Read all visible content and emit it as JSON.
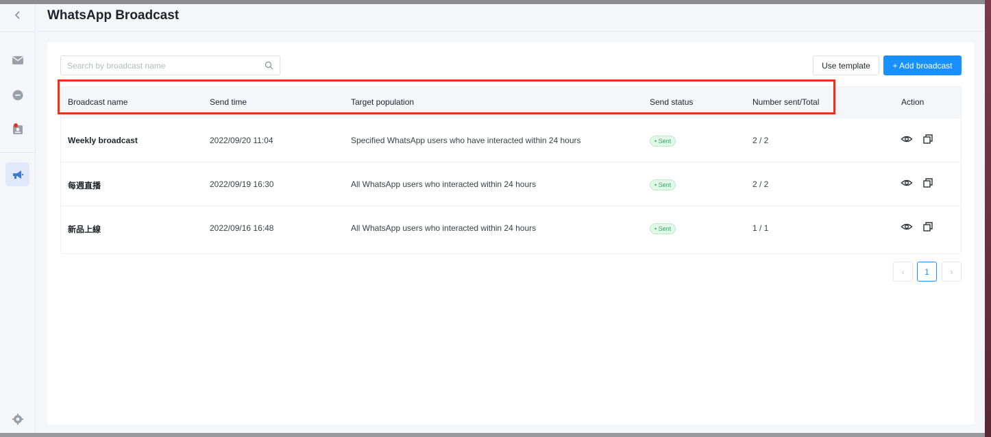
{
  "page": {
    "title": "WhatsApp Broadcast"
  },
  "sidebar": {
    "items": [
      {
        "name": "back",
        "icon": "chevron-left-icon"
      },
      {
        "name": "inbox",
        "icon": "mail-icon"
      },
      {
        "name": "chat",
        "icon": "chat-bubble-icon"
      },
      {
        "name": "contacts",
        "icon": "contact-card-icon"
      },
      {
        "name": "broadcast",
        "icon": "megaphone-icon",
        "active": true
      },
      {
        "name": "settings",
        "icon": "gear-icon"
      }
    ]
  },
  "toolbar": {
    "search_placeholder": "Search by broadcast name",
    "search_value": "",
    "use_template_label": "Use template",
    "add_broadcast_label": "+ Add broadcast"
  },
  "table": {
    "columns": [
      "Broadcast name",
      "Send time",
      "Target population",
      "Send status",
      "Number sent/Total",
      "Action"
    ],
    "rows": [
      {
        "name": "Weekly broadcast",
        "send_time": "2022/09/20 11:04",
        "target": "Specified WhatsApp users who have interacted within 24 hours",
        "status": "• Sent",
        "count": "2 / 2"
      },
      {
        "name": "每週直播",
        "send_time": "2022/09/19 16:30",
        "target": "All WhatsApp users who interacted within 24 hours",
        "status": "• Sent",
        "count": "2 / 2"
      },
      {
        "name": "新品上線",
        "send_time": "2022/09/16 16:48",
        "target": "All WhatsApp users who interacted within 24 hours",
        "status": "• Sent",
        "count": "1 / 1"
      }
    ]
  },
  "pagination": {
    "prev": "‹",
    "current": "1",
    "next": "›"
  },
  "colors": {
    "accent": "#1890ff",
    "status_sent": "#27ae60",
    "highlight": "#e8321c"
  }
}
